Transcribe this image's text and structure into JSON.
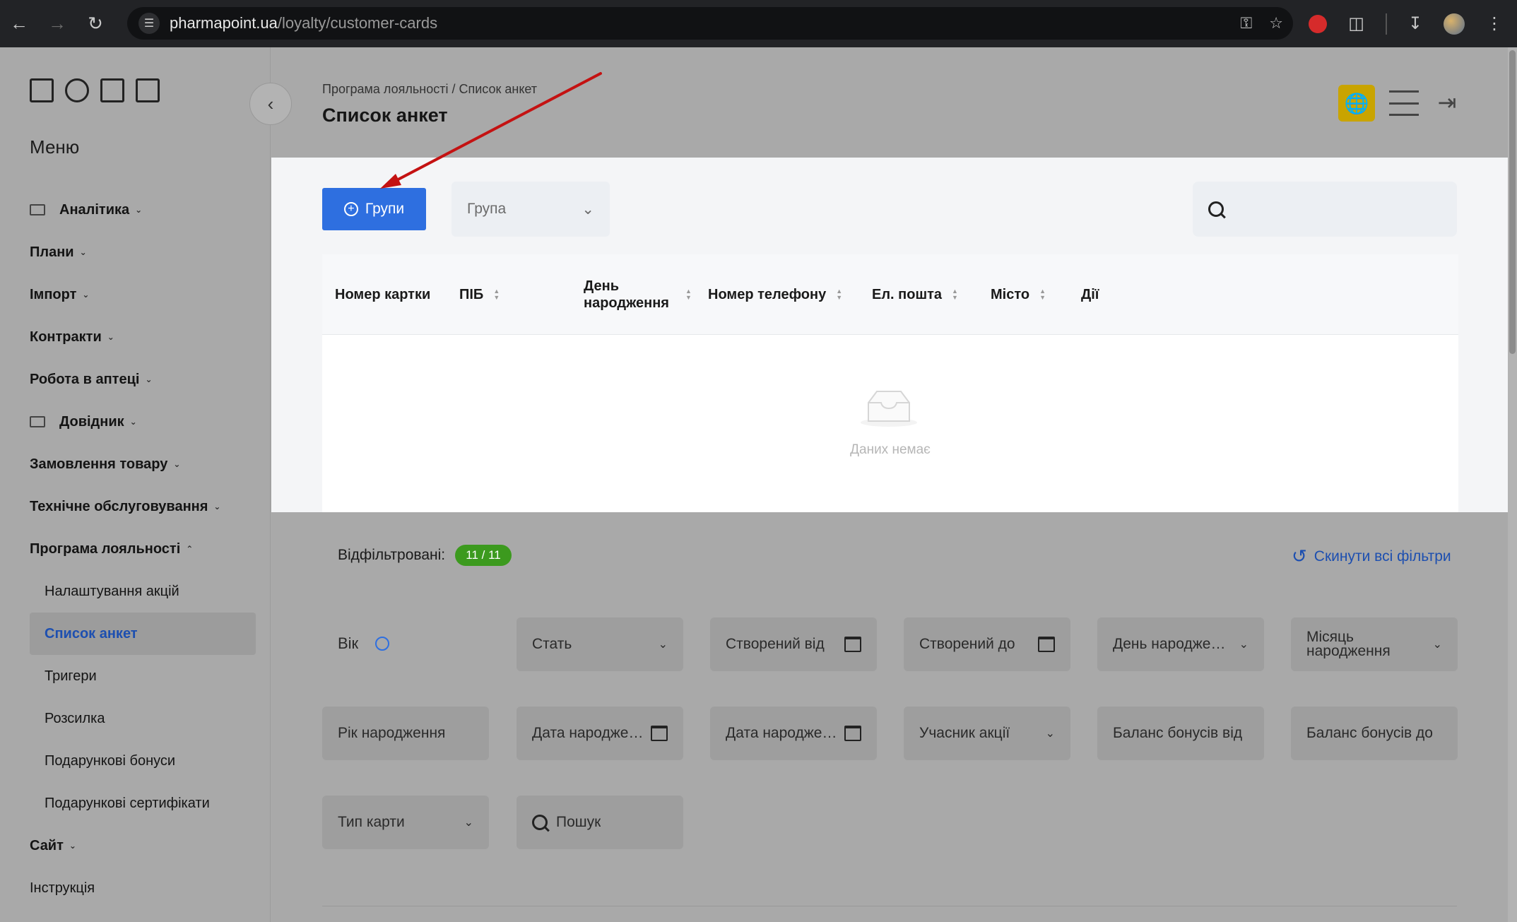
{
  "browser": {
    "url_host": "pharmapoint.ua",
    "url_path": "/loyalty/customer-cards"
  },
  "sidebar": {
    "menu_title": "Меню",
    "items": [
      {
        "label": "Аналітика",
        "level": "top",
        "icon": "grid-icon"
      },
      {
        "label": "Плани",
        "level": "top"
      },
      {
        "label": "Імпорт",
        "level": "top"
      },
      {
        "label": "Контракти",
        "level": "top"
      },
      {
        "label": "Робота в аптеці",
        "level": "top"
      },
      {
        "label": "Довідник",
        "level": "top",
        "icon": "list-icon"
      },
      {
        "label": "Замовлення товару",
        "level": "top"
      },
      {
        "label": "Технічне обслуговування",
        "level": "top"
      },
      {
        "label": "Програма лояльності",
        "level": "top",
        "expanded": true
      },
      {
        "label": "Налаштування акцій",
        "level": "sub"
      },
      {
        "label": "Список анкет",
        "level": "sub",
        "active": true
      },
      {
        "label": "Тригери",
        "level": "sub"
      },
      {
        "label": "Розсилка",
        "level": "sub"
      },
      {
        "label": "Подарункові бонуси",
        "level": "sub"
      },
      {
        "label": "Подарункові сертифікати",
        "level": "sub"
      },
      {
        "label": "Сайт",
        "level": "top"
      },
      {
        "label": "Інструкція",
        "level": "plain"
      }
    ]
  },
  "header": {
    "breadcrumb": "Програма лояльності / Список анкет",
    "title": "Список анкет"
  },
  "toolbar": {
    "groups_label": "Групи",
    "group_placeholder": "Група"
  },
  "table": {
    "columns": [
      "Номер картки",
      "ПІБ",
      "День народження",
      "Номер телефону",
      "Ел. пошта",
      "Місто",
      "Дії"
    ],
    "empty_text": "Даних немає"
  },
  "filters": {
    "filtered_label": "Відфільтровані:",
    "filtered_count": "11 / 11",
    "reset_label": "Скинути всі фільтри",
    "age_label": "Вік",
    "fields": {
      "gender": "Стать",
      "created_from": "Створений від",
      "created_to": "Створений до",
      "birth_day": "День народження",
      "birth_month": "Місяць народження",
      "birth_year": "Рік народження",
      "birth_date_from": "Дата народжен...",
      "birth_date_to": "Дата народжен...",
      "promo_participant": "Учасник акції",
      "bonus_from": "Баланс бонусів від",
      "bonus_to": "Баланс бонусів до",
      "card_type": "Тип карти",
      "search": "Пошук"
    }
  },
  "colors": {
    "primary": "#2e6fe0",
    "badge_green": "#3c9a1e",
    "globe_yellow": "#c9a400",
    "annotation_arrow": "#c41212"
  }
}
